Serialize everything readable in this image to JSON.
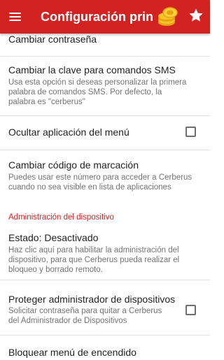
{
  "appbar": {
    "title": "Configuración prin",
    "icons": [
      "menu-icon",
      "coins-icon",
      "star-icon"
    ],
    "color": "#d32222"
  },
  "items": [
    {
      "title": "Cambiar contraseña"
    },
    {
      "title": "Cambiar la clave para comandos SMS",
      "sub1": "Usa esta opción si deseas personalizar la primera",
      "sub2": "palabra de comandos SMS. Por defecto, la",
      "sub3": "palabra es \"cerberus\""
    },
    {
      "title": "Ocultar aplicación del menú",
      "checked": false
    },
    {
      "title": "Cambiar código de marcación",
      "sub1": "Puedes usar este número para acceder a Cerberus",
      "sub2": "cuando no sea visible en lista de aplicaciones"
    }
  ],
  "section": {
    "header": "Administración del dispositivo"
  },
  "admin_items": [
    {
      "title": "Estado: Desactivado",
      "sub1": "Haz clic aquí para habilitar la administración del",
      "sub2": "dispositivo, para que Cerberus pueda realizar el",
      "sub3": "bloqueo y borrado remoto."
    },
    {
      "title": "Proteger administrador de dispositivos",
      "sub1": "Solicitar contraseña para quitar a Cerberus",
      "sub2": "del Administrador de Dispositivos",
      "checked": false
    },
    {
      "title": "Bloquear menú de encendido"
    }
  ]
}
